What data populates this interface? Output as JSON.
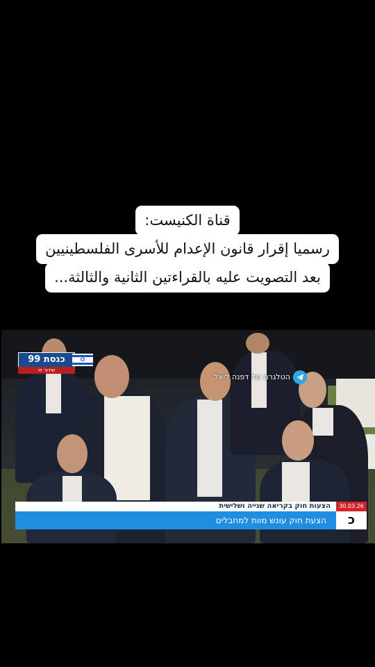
{
  "caption": {
    "line1": "قناة الكنيست:",
    "line2": "رسميا إقرار قانون الإعدام للأسرى الفلسطينيين",
    "line3": "بعد التصويت عليه بالقراءتين الثانية والثالثة..."
  },
  "video": {
    "channel_logo": "כנסת 99",
    "channel_sub": "שידור חי",
    "telegram_badge": "הטלגרם של דפנה ליאל",
    "ticker_top": "הצעות חוק בקריאה שנייה ושלישית",
    "ticker_date": "30.03.26",
    "ticker_main": "הצעת חוק עונש מוות למחבלים",
    "corner_logo": "כ"
  },
  "icons": [
    "telegram-icon",
    "israel-flag-icon"
  ],
  "colors": {
    "ticker_blue": "#1f8ee0",
    "date_red": "#d0262b",
    "knesset_blue": "#1a4b8e"
  }
}
